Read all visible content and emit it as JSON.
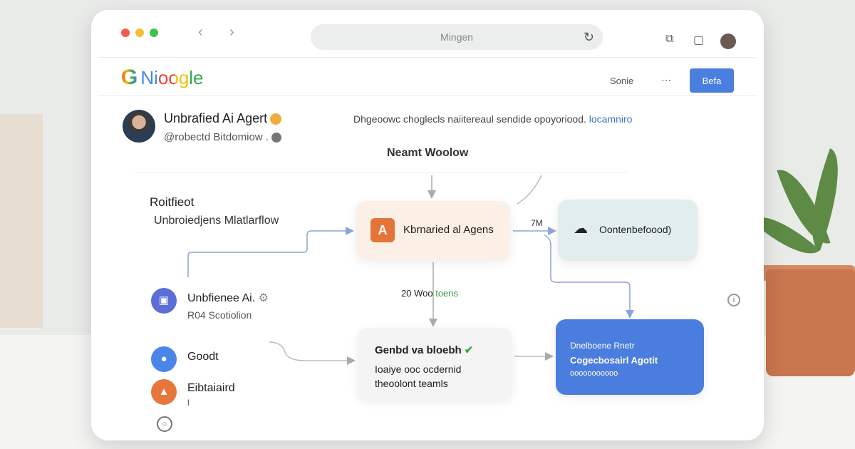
{
  "window": {
    "url_text": "Mingen",
    "nav_back": "‹",
    "nav_forward": "›",
    "reload_icon": "reload-icon"
  },
  "header": {
    "logo_letter": "G",
    "logo_text": "Nioogle",
    "link": "Sonie",
    "button": "Befa"
  },
  "profile": {
    "name": "Unbrafied Ai Agert",
    "handle": "@robectd Bitdomiow .",
    "description": "Dhgeoowc choglecls naiitereaul sendide opoyoriood.",
    "link": "locamniro"
  },
  "flow": {
    "title": "Neamt Woolow",
    "section_title": "Roitfieot",
    "section_sub": "Unbroiedjens Mlatlarflow",
    "node_main": "Kbrnaried al Agens",
    "node_cloud": "Oontenbefoood)",
    "arrow_label": "7M",
    "mid_label_num": "20 Woo",
    "mid_label_green": "toens",
    "node_done_title": "Genbd va bloebh",
    "node_done_l1": "Ioaiye ooc ocdernid",
    "node_done_l2": "theoolont teamls",
    "node_blue_l1": "Dnelboene Rnetr",
    "node_blue_l2": "Cogecbosairl Agotit",
    "node_blue_l3": "ooooooooooo"
  },
  "sidebar": {
    "items": [
      {
        "label": "Unbfienee Ai.",
        "sub": "R04 Scotiolion"
      },
      {
        "label": "Goodt"
      },
      {
        "label": "Eibtaiaird",
        "sub": "l"
      }
    ]
  },
  "colors": {
    "accent": "#4a7fe0",
    "orange": "#e4743a",
    "green": "#3aaa44"
  }
}
